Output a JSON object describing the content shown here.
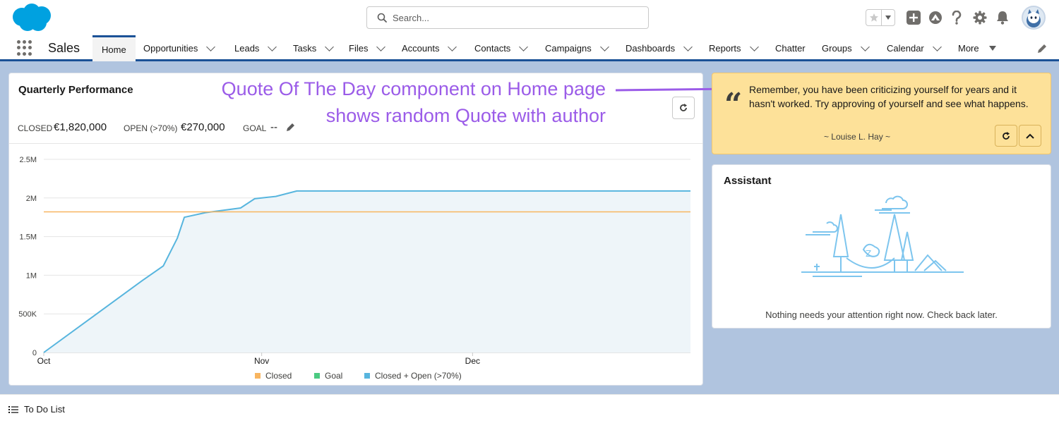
{
  "header": {
    "app_name": "Sales",
    "search_placeholder": "Search..."
  },
  "nav": {
    "items": [
      {
        "label": "Home"
      },
      {
        "label": "Opportunities"
      },
      {
        "label": "Leads"
      },
      {
        "label": "Tasks"
      },
      {
        "label": "Files"
      },
      {
        "label": "Accounts"
      },
      {
        "label": "Contacts"
      },
      {
        "label": "Campaigns"
      },
      {
        "label": "Dashboards"
      },
      {
        "label": "Reports"
      },
      {
        "label": "Chatter"
      },
      {
        "label": "Groups"
      },
      {
        "label": "Calendar"
      },
      {
        "label": "More"
      }
    ]
  },
  "performance": {
    "title": "Quarterly Performance",
    "closed_label": "CLOSED",
    "closed_value": "€1,820,000",
    "open_label": "OPEN (>70%)",
    "open_value": "€270,000",
    "goal_label": "GOAL",
    "goal_value": "--"
  },
  "annotation": {
    "line1": "Quote Of The Day component on Home page",
    "line2": "shows random Quote with author"
  },
  "quote": {
    "text": "Remember, you have been criticizing yourself for years and it hasn't worked. Try approving of yourself and see what happens.",
    "author": "~ Louise L. Hay ~"
  },
  "assistant": {
    "title": "Assistant",
    "message": "Nothing needs your attention right now. Check back later."
  },
  "utility": {
    "todo_label": "To Do List"
  },
  "colors": {
    "closed": "#f8b560",
    "goal": "#4bca81",
    "closed_open": "#57b5de",
    "brand": "#1b5297"
  },
  "chart_data": {
    "type": "area",
    "y_tick_labels": [
      "0",
      "500K",
      "1M",
      "1.5M",
      "2M",
      "2.5M"
    ],
    "y_ticks": [
      0,
      500000,
      1000000,
      1500000,
      2000000,
      2500000
    ],
    "ylim": [
      0,
      2500000
    ],
    "x_tick_labels": [
      "Oct",
      "Nov",
      "Dec"
    ],
    "x_ticks": [
      "2023-10-01",
      "2023-11-01",
      "2023-12-01"
    ],
    "xlim": [
      "2023-10-01",
      "2023-12-31"
    ],
    "series": [
      {
        "name": "Closed",
        "x": [
          "2023-10-01",
          "2023-12-31"
        ],
        "y": [
          1820000,
          1820000
        ]
      },
      {
        "name": "Goal",
        "x": [],
        "y": []
      },
      {
        "name": "Closed + Open (>70%)",
        "x": [
          "2023-10-01",
          "2023-10-15",
          "2023-10-18",
          "2023-10-20",
          "2023-10-21",
          "2023-10-24",
          "2023-10-29",
          "2023-10-31",
          "2023-11-03",
          "2023-11-06"
        ],
        "y": [
          0,
          930000,
          1120000,
          1480000,
          1750000,
          1810000,
          1870000,
          1990000,
          2020000,
          2090000
        ]
      }
    ],
    "grid": true,
    "legend": "bottom"
  }
}
